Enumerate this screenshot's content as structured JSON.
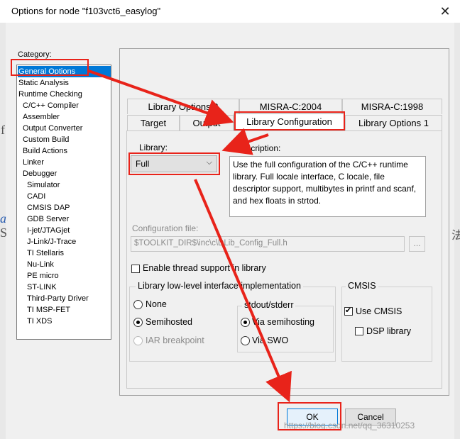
{
  "window": {
    "title": "Options for node \"f103vct6_easylog\"",
    "close_glyph": "✕"
  },
  "background_text": [
    "f",
    "a",
    "S",
    "法"
  ],
  "category": {
    "label": "Category:",
    "items": [
      {
        "label": "General Options",
        "selected": true
      },
      {
        "label": "Static Analysis"
      },
      {
        "label": "Runtime Checking"
      },
      {
        "label": "C/C++ Compiler"
      },
      {
        "label": "Assembler"
      },
      {
        "label": "Output Converter"
      },
      {
        "label": "Custom Build"
      },
      {
        "label": "Build Actions"
      },
      {
        "label": "Linker"
      },
      {
        "label": "Debugger"
      },
      {
        "label": "Simulator"
      },
      {
        "label": "CADI"
      },
      {
        "label": "CMSIS DAP"
      },
      {
        "label": "GDB Server"
      },
      {
        "label": "I-jet/JTAGjet"
      },
      {
        "label": "J-Link/J-Trace"
      },
      {
        "label": "TI Stellaris"
      },
      {
        "label": "Nu-Link"
      },
      {
        "label": "PE micro"
      },
      {
        "label": "ST-LINK"
      },
      {
        "label": "Third-Party Driver"
      },
      {
        "label": "TI MSP-FET"
      },
      {
        "label": "TI XDS"
      }
    ]
  },
  "tabs": {
    "back_row": [
      "Library Options 2",
      "MISRA-C:2004",
      "MISRA-C:1998"
    ],
    "front_row": [
      "Target",
      "Output",
      "Library Configuration",
      "Library Options 1"
    ],
    "active": "Library Configuration"
  },
  "library": {
    "label": "Library:",
    "value": "Full",
    "chevron": "⌵"
  },
  "description": {
    "label": "Description:",
    "text": "Use the full configuration of the C/C++ runtime library. Full locale interface, C locale, file descriptor support, multibytes in printf and scanf, and hex floats in strtod."
  },
  "config_file": {
    "label": "Configuration file:",
    "value": "$TOOLKIT_DIR$\\inc\\c\\DLib_Config_Full.h",
    "browse": "..."
  },
  "thread_support": {
    "label": "Enable thread support in library",
    "checked": false
  },
  "lowlevel": {
    "title": "Library low-level interface implementation",
    "options": [
      {
        "label": "None",
        "on": false
      },
      {
        "label": "Semihosted",
        "on": true
      },
      {
        "label": "IAR breakpoint",
        "on": false,
        "disabled": true
      }
    ],
    "stdout": {
      "title": "stdout/stderr",
      "options": [
        {
          "label": "Via semihosting",
          "on": true
        },
        {
          "label": "Via SWO",
          "on": false
        }
      ]
    }
  },
  "cmsis": {
    "title": "CMSIS",
    "use_cmsis": {
      "label": "Use CMSIS",
      "checked": true
    },
    "dsp": {
      "label": "DSP library",
      "checked": false
    }
  },
  "buttons": {
    "ok": "OK",
    "cancel": "Cancel"
  },
  "watermark": "https://blog.csdn.net/qq_36310253",
  "colors": {
    "selection": "#0078d7",
    "annotation": "#e8231a"
  }
}
